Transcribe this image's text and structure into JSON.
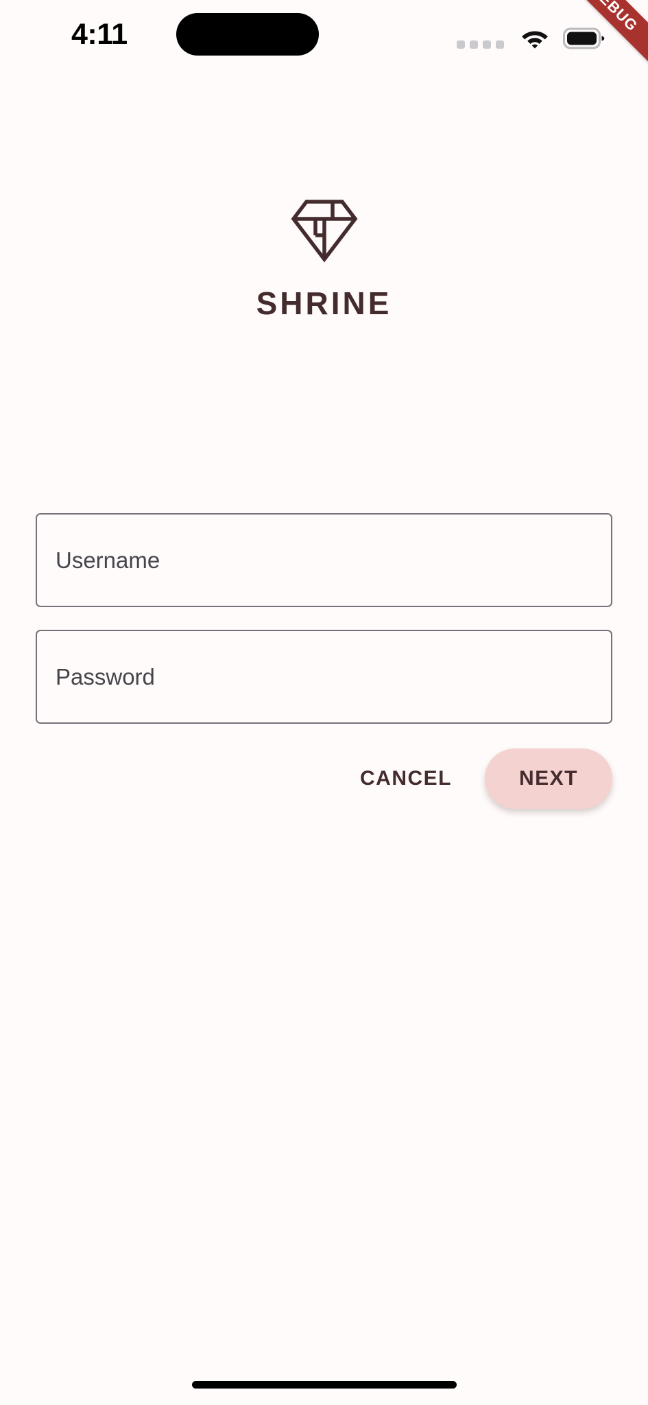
{
  "app": {
    "name": "Shrine",
    "background_color": "#FFFBFA",
    "brand_color": "#442C2E",
    "accent_color": "#F3D2CF"
  },
  "status_bar": {
    "time": "4:11",
    "icons": {
      "signal": "signal-dots-icon",
      "wifi": "wifi-icon",
      "battery": "battery-full-icon",
      "island": "dynamic-island"
    }
  },
  "debug_banner": {
    "label": "DEBUG",
    "color": "#A8322E",
    "text_color": "#FFFFFF"
  },
  "brand": {
    "logo_icon": "diamond-logo-icon",
    "title": "SHRINE"
  },
  "form": {
    "fields": [
      {
        "name": "username",
        "label": "Username",
        "value": "",
        "placeholder": "Username",
        "obscured": false
      },
      {
        "name": "password",
        "label": "Password",
        "value": "",
        "placeholder": "Password",
        "obscured": true
      }
    ],
    "border_color": "#757179",
    "label_color": "#45454B"
  },
  "actions": {
    "cancel_label": "CANCEL",
    "next_label": "NEXT"
  },
  "system": {
    "home_indicator": "home-indicator"
  }
}
